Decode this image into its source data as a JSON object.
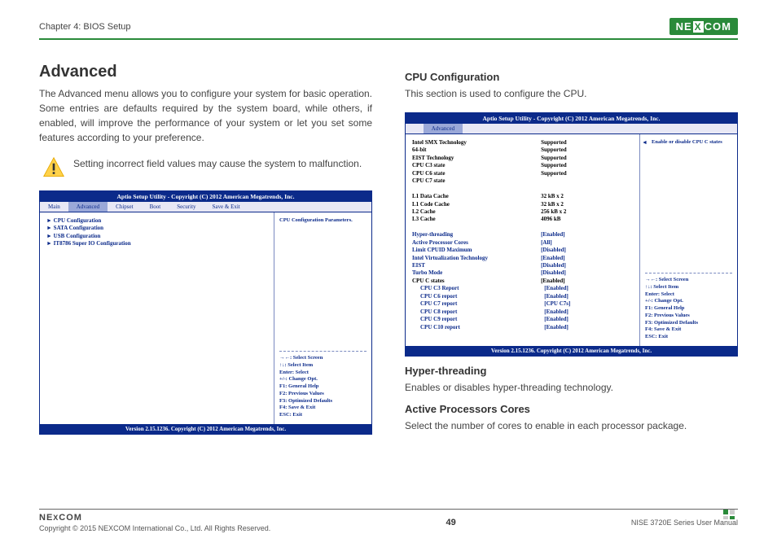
{
  "header": {
    "chapter": "Chapter 4: BIOS Setup",
    "logo_text": "NEXCOM"
  },
  "left": {
    "h1": "Advanced",
    "intro": "The Advanced menu allows you to configure your system for basic operation. Some entries are defaults required by the system board, while others, if enabled, will improve the performance of your system or let you set some features according to your preference.",
    "warning": "Setting incorrect field values may cause the system to malfunction."
  },
  "right": {
    "h2": "CPU Configuration",
    "intro": "This section is used to configure the CPU.",
    "ht_h": "Hyper-threading",
    "ht_b": "Enables or disables hyper-threading technology.",
    "apc_h": "Active Processors Cores",
    "apc_b": "Select the number of cores to enable in each processor package."
  },
  "bios_common": {
    "title": "Aptio Setup Utility - Copyright (C) 2012 American Megatrends, Inc.",
    "version": "Version 2.15.1236. Copyright (C) 2012 American Megatrends, Inc.",
    "tabs": [
      "Main",
      "Advanced",
      "Chipset",
      "Boot",
      "Security",
      "Save & Exit"
    ],
    "help_lines": [
      "→←: Select Screen",
      "↑↓: Select Item",
      "Enter: Select",
      "+/-: Change Opt.",
      "F1: General Help",
      "F2: Previous Values",
      "F3: Optimized Defaults",
      "F4: Save & Exit",
      "ESC: Exit"
    ]
  },
  "bios_left": {
    "side_hint": "CPU Configuration Parameters.",
    "items": [
      "► CPU Configuration",
      "► SATA Configuration",
      "► USB Configuration",
      "► IT8786 Super IO Configuration"
    ]
  },
  "bios_right": {
    "side_hint": "Enable or disable CPU C states",
    "info": [
      {
        "lbl": "Intel SMX Technology",
        "val": "Supported"
      },
      {
        "lbl": "64-bit",
        "val": "Supported"
      },
      {
        "lbl": "EIST Technology",
        "val": "Supported"
      },
      {
        "lbl": "CPU C3 state",
        "val": "Supported"
      },
      {
        "lbl": "CPU C6 state",
        "val": "Supported"
      },
      {
        "lbl": "CPU C7 state",
        "val": ""
      }
    ],
    "cache": [
      {
        "lbl": "L1 Data Cache",
        "val": "32 kB x 2"
      },
      {
        "lbl": "L1 Code Cache",
        "val": "32 kB x 2"
      },
      {
        "lbl": "L2 Cache",
        "val": "256 kB x 2"
      },
      {
        "lbl": "L3 Cache",
        "val": "4096 kB"
      }
    ],
    "opts": [
      {
        "lbl": "Hyper-threading",
        "val": "[Enabled]"
      },
      {
        "lbl": "Active Processor Cores",
        "val": "[All]"
      },
      {
        "lbl": "Limit CPUID Maximum",
        "val": "[Disabled]"
      },
      {
        "lbl": "Intel Virtualization Technology",
        "val": "[Enabled]"
      },
      {
        "lbl": "EIST",
        "val": "[Disabled]"
      },
      {
        "lbl": "Turbo Mode",
        "val": "[Disabled]"
      }
    ],
    "cstates_head": {
      "lbl": "CPU C states",
      "val": "[Enabled]"
    },
    "cstates": [
      {
        "lbl": "CPU C3 Report",
        "val": "[Enabled]"
      },
      {
        "lbl": "CPU C6 report",
        "val": "[Enabled]"
      },
      {
        "lbl": "CPU C7 report",
        "val": "[CPU C7s]"
      },
      {
        "lbl": "CPU C8 report",
        "val": "[Enabled]"
      },
      {
        "lbl": "CPU C9 report",
        "val": "[Enabled]"
      },
      {
        "lbl": "CPU C10 report",
        "val": "[Enabled]"
      }
    ]
  },
  "footer": {
    "copyright": "Copyright © 2015 NEXCOM International Co., Ltd. All Rights Reserved.",
    "page": "49",
    "manual": "NISE 3720E Series User Manual"
  }
}
